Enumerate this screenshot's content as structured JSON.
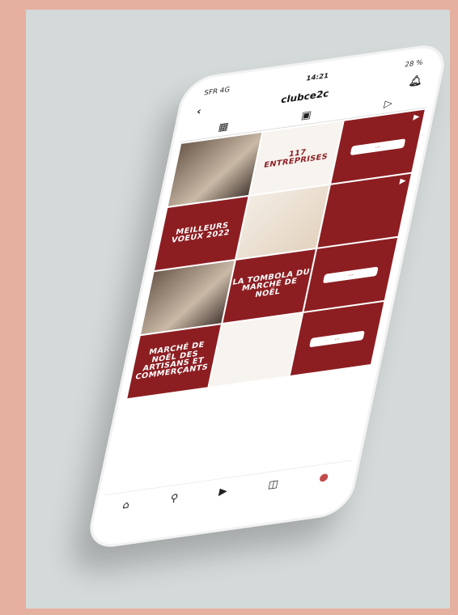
{
  "status": {
    "carrier": "SFR 4G",
    "time": "14:21",
    "battery": "28 %"
  },
  "header": {
    "username": "clubce2c"
  },
  "tiles": [
    {
      "type": "photo",
      "text": ""
    },
    {
      "type": "white",
      "text": "117 ENTREPRISES"
    },
    {
      "type": "bubble",
      "text": ""
    },
    {
      "type": "red",
      "text": "MEILLEURS VOEUX 2022"
    },
    {
      "type": "light",
      "text": ""
    },
    {
      "type": "red",
      "text": ""
    },
    {
      "type": "photo",
      "text": ""
    },
    {
      "type": "red",
      "text": "LA TOMBOLA DU MARCHÉ DE NOËL"
    },
    {
      "type": "bubble",
      "text": ""
    },
    {
      "type": "red",
      "text": "MARCHÉ DE NOËL DES ARTISANS ET COMMERÇANTS"
    },
    {
      "type": "white",
      "text": ""
    },
    {
      "type": "bubble",
      "text": ""
    }
  ],
  "nav": {
    "home": "⌂",
    "search": "⚲",
    "reels": "▶",
    "shop": "◫",
    "profile": "●"
  }
}
